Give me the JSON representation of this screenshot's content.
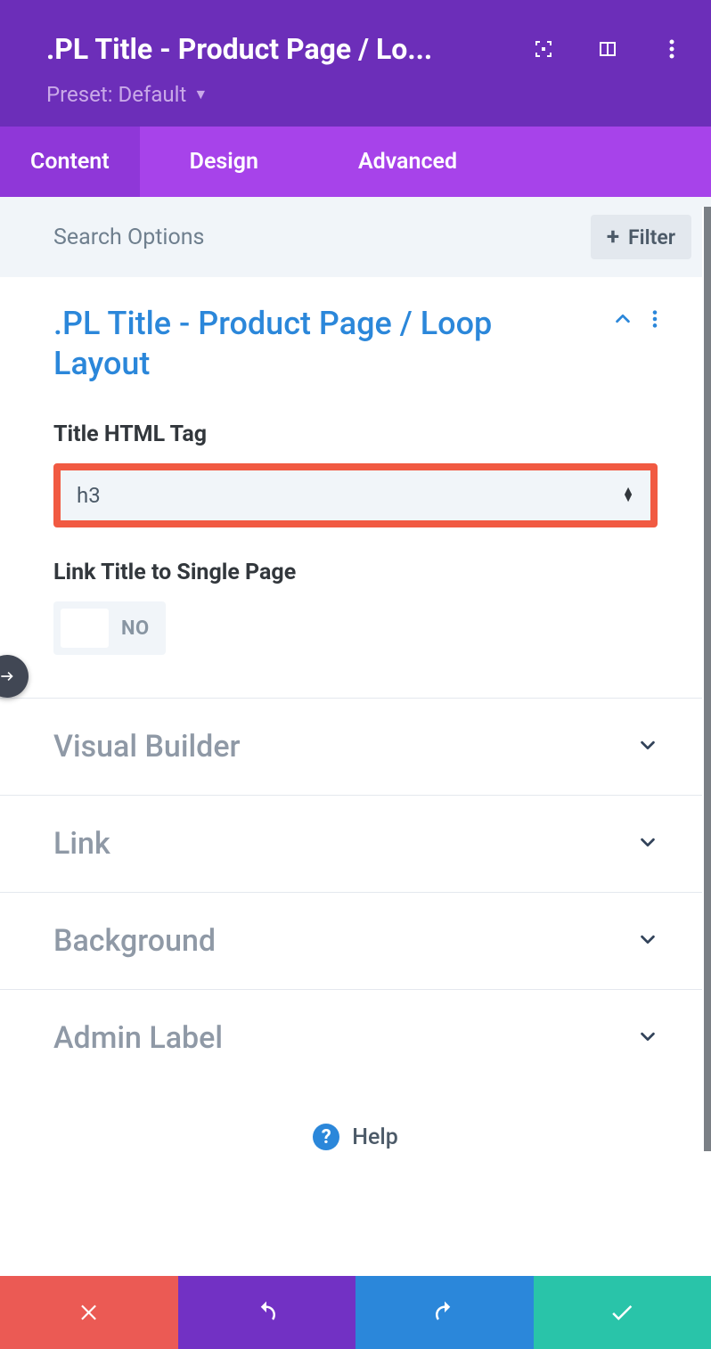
{
  "header": {
    "title": ".PL Title - Product Page / Lo...",
    "preset_label": "Preset: Default"
  },
  "tabs": {
    "content": "Content",
    "design": "Design",
    "advanced": "Advanced"
  },
  "search": {
    "placeholder": "Search Options",
    "filter_label": "Filter"
  },
  "section_open": {
    "title": ".PL Title - Product Page / Loop Layout",
    "field_title_html_tag": "Title HTML Tag",
    "select_value": "h3",
    "field_link_title": "Link Title to Single Page",
    "toggle_value": "NO"
  },
  "collapsed": [
    {
      "label": "Visual Builder"
    },
    {
      "label": "Link"
    },
    {
      "label": "Background"
    },
    {
      "label": "Admin Label"
    }
  ],
  "help": {
    "label": "Help"
  }
}
